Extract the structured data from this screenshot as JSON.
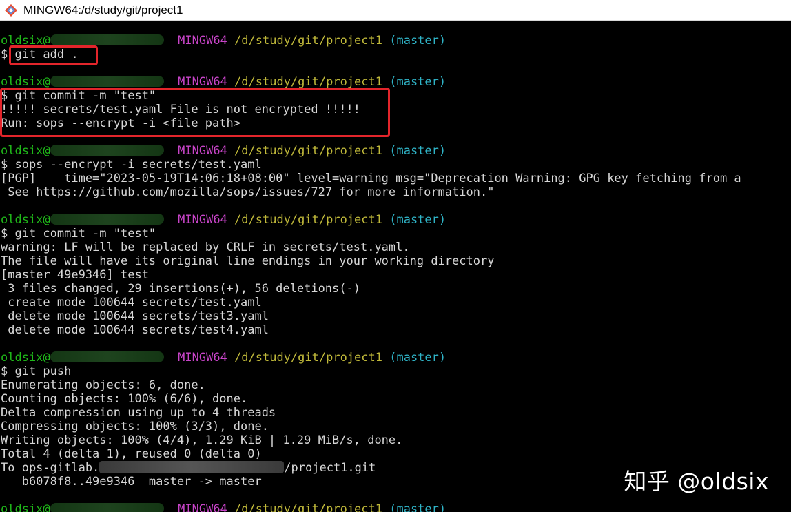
{
  "window": {
    "title": "MINGW64:/d/study/git/project1"
  },
  "prompt": {
    "user": "oldsix@",
    "shell": "MINGW64",
    "path": "/d/study/git/project1",
    "branch": "(master)"
  },
  "session": [
    {
      "cmd": "$ git add .",
      "out": []
    },
    {
      "cmd": "$ git commit -m \"test\"",
      "out": [
        "!!!!! secrets/test.yaml File is not encrypted !!!!!",
        "Run: sops --encrypt -i <file path>"
      ]
    },
    {
      "cmd": "$ sops --encrypt -i secrets/test.yaml",
      "out": [
        "[PGP]    time=\"2023-05-19T14:06:18+08:00\" level=warning msg=\"Deprecation Warning: GPG key fetching from a",
        " See https://github.com/mozilla/sops/issues/727 for more information.\""
      ]
    },
    {
      "cmd": "$ git commit -m \"test\"",
      "out": [
        "warning: LF will be replaced by CRLF in secrets/test.yaml.",
        "The file will have its original line endings in your working directory",
        "[master 49e9346] test",
        " 3 files changed, 29 insertions(+), 56 deletions(-)",
        " create mode 100644 secrets/test.yaml",
        " delete mode 100644 secrets/test3.yaml",
        " delete mode 100644 secrets/test4.yaml"
      ]
    },
    {
      "cmd": "$ git push",
      "out": [
        "Enumerating objects: 6, done.",
        "Counting objects: 100% (6/6), done.",
        "Delta compression using up to 4 threads",
        "Compressing objects: 100% (3/3), done.",
        "Writing objects: 100% (4/4), 1.29 KiB | 1.29 MiB/s, done.",
        "Total 4 (delta 1), reused 0 (delta 0)"
      ]
    }
  ],
  "push_remote": {
    "prefix": "To ops-gitlab.",
    "suffix": "/project1.git"
  },
  "push_result": "   b6078f8..49e9346  master -> master",
  "watermark": "知乎 @oldsix",
  "colors": {
    "user": "#1fb819",
    "shell": "#c844c8",
    "path": "#c0b93a",
    "branch": "#2fb3c6",
    "highlight": "#e3252b"
  }
}
